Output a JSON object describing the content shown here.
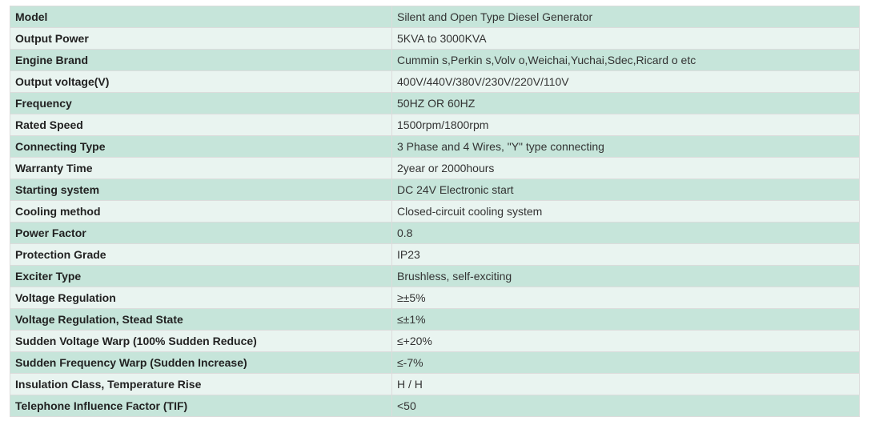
{
  "colors": {
    "row_odd": "#c6e5da",
    "row_even": "#e9f4f0",
    "border": "#dcdcdc"
  },
  "spec_table": {
    "rows": [
      {
        "label": "Model",
        "value": "Silent and Open Type Diesel Generator"
      },
      {
        "label": "Output Power",
        "value": "5KVA to 3000KVA"
      },
      {
        "label": "Engine Brand",
        "value": "Cummin s,Perkin s,Volv o,Weichai,Yuchai,Sdec,Ricard o etc"
      },
      {
        "label": "Output voltage(V)",
        "value": "400V/440V/380V/230V/220V/110V"
      },
      {
        "label": "Frequency",
        "value": "50HZ OR 60HZ"
      },
      {
        "label": "Rated Speed",
        "value": "1500rpm/1800rpm"
      },
      {
        "label": "Connecting Type",
        "value": "3 Phase and 4 Wires, \"Y\" type connecting"
      },
      {
        "label": "Warranty Time",
        "value": "2year or 2000hours"
      },
      {
        "label": "Starting system",
        "value": "DC 24V Electronic start"
      },
      {
        "label": "Cooling method",
        "value": "Closed-circuit cooling system"
      },
      {
        "label": "Power Factor",
        "value": "0.8"
      },
      {
        "label": "Protection Grade",
        "value": "IP23"
      },
      {
        "label": "Exciter Type",
        "value": "Brushless, self-exciting"
      },
      {
        "label": "Voltage Regulation",
        "value": "≥±5%"
      },
      {
        "label": "Voltage Regulation, Stead State",
        "value": "≤±1%"
      },
      {
        "label": "Sudden Voltage Warp (100% Sudden Reduce)",
        "value": "≤+20%"
      },
      {
        "label": "Sudden Frequency Warp (Sudden Increase)",
        "value": "≤-7%"
      },
      {
        "label": "Insulation Class, Temperature Rise",
        "value": "H / H"
      },
      {
        "label": "Telephone Influence Factor (TIF)",
        "value": "<50"
      }
    ]
  }
}
